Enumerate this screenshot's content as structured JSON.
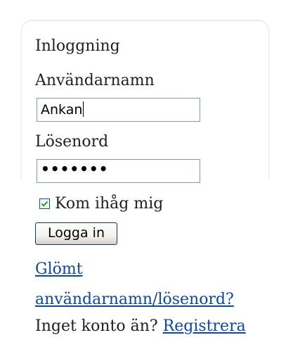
{
  "login": {
    "title": "Inloggning",
    "username_label": "Användarnamn",
    "username_value": "Ankan",
    "password_label": "Lösenord",
    "password_value": "•••••••",
    "remember_label": "Kom ihåg mig",
    "remember_checked": true,
    "submit_label": "Logga in",
    "forgot_line1": "Glömt",
    "forgot_line2": "användarnamn/lösenord?",
    "no_account_text": "Inget konto än?",
    "register_link": "Registrera"
  },
  "colors": {
    "link": "#0b47a8",
    "input_border": "#7f9db9",
    "checkmark": "#21a121"
  }
}
